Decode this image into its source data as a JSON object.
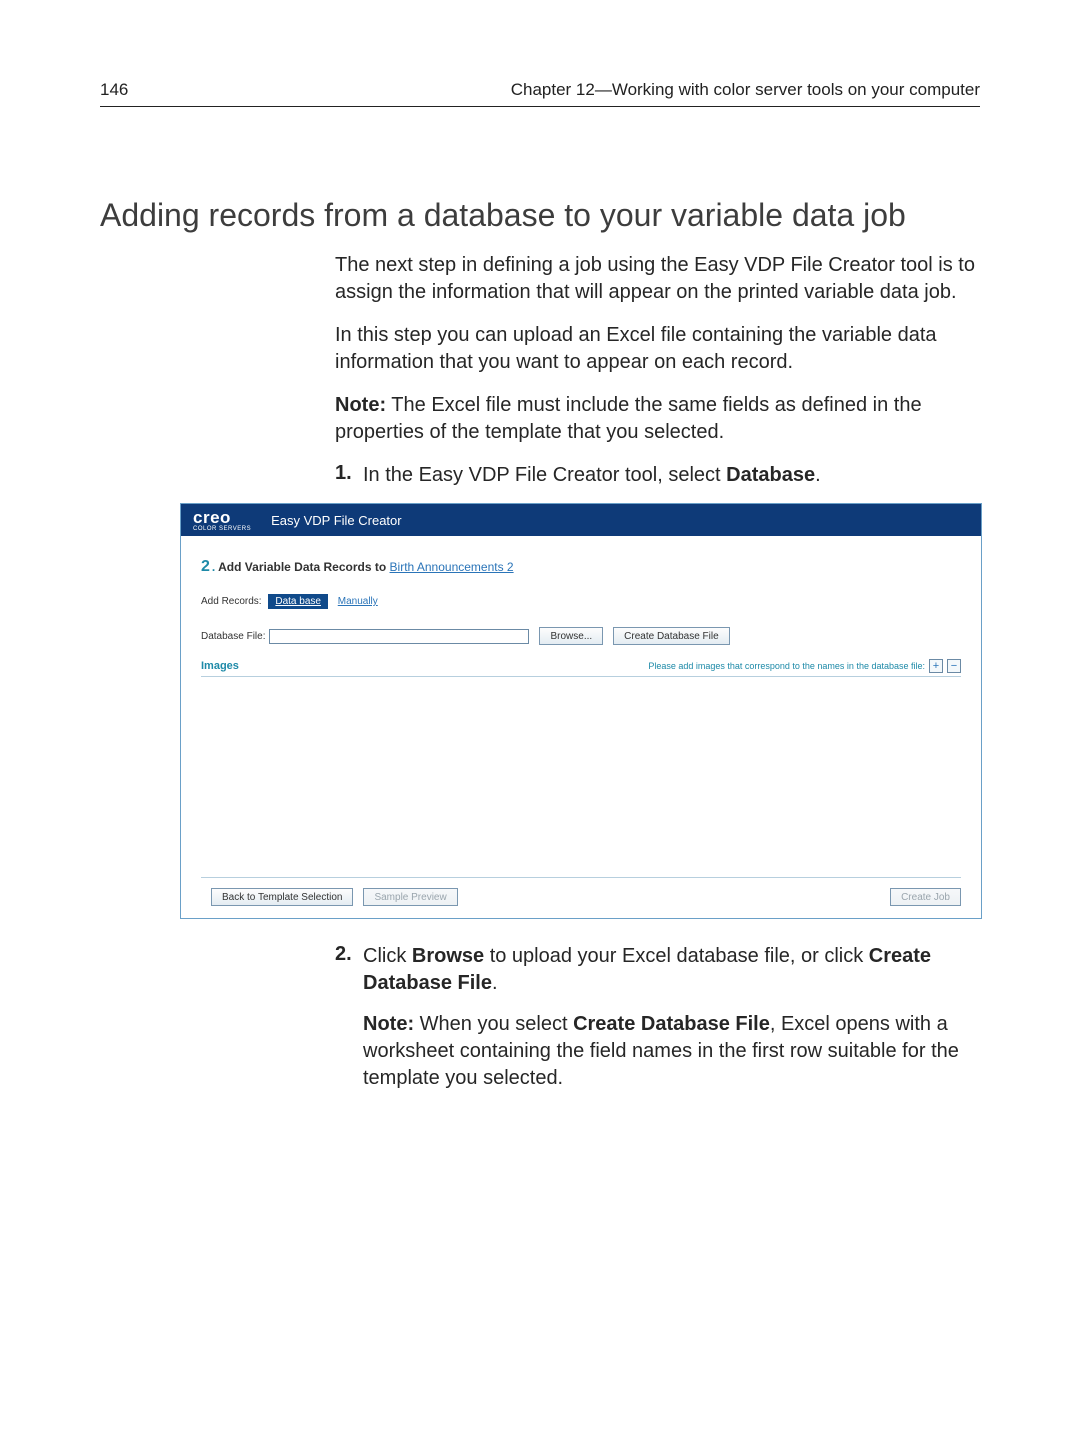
{
  "page": {
    "number": "146",
    "chapter": "Chapter 12—Working with color server tools on your computer"
  },
  "title": "Adding records from a database to your variable data job",
  "intro": {
    "p1": "The next step in defining a job using the Easy VDP File Creator tool is to assign the information that will appear on the printed variable data job.",
    "p2": "In this step you can upload an Excel file containing the variable data information that you want to appear on each record."
  },
  "note1": {
    "label": "Note:",
    "text": " The Excel file must include the same fields as defined in the properties of the template that you selected."
  },
  "steps": {
    "s1": {
      "num": "1.",
      "pre": "In the Easy VDP File Creator tool, select ",
      "bold": "Database",
      "post": "."
    },
    "s2": {
      "num": "2.",
      "pre": "Click ",
      "bold1": "Browse",
      "mid": " to upload your Excel database file, or click ",
      "bold2": "Create Database File",
      "post": "."
    }
  },
  "note2": {
    "label": "Note:",
    "pre": " When you select ",
    "bold": "Create Database File",
    "post": ", Excel opens with a worksheet containing the field names in the first row suitable for the template you selected."
  },
  "app": {
    "logo": "creo",
    "logo_sub": "COLOR SERVERS",
    "title": "Easy VDP File Creator",
    "step_num": "2",
    "step_dot": ".",
    "step_label": " Add Variable Data Records to ",
    "template_name": "Birth Announcements 2",
    "add_records_label": "Add Records:",
    "tab_database": "Data base",
    "tab_manually": "Manually",
    "dbfile_label": "Database File:",
    "dbfile_value": "",
    "browse": "Browse...",
    "create_db": "Create Database File",
    "images_label": "Images",
    "images_hint": "Please add images that correspond to the names in the database file:",
    "plus": "+",
    "minus": "−",
    "back_btn": "Back to Template Selection",
    "sample_btn": "Sample Preview",
    "create_job_btn": "Create Job"
  }
}
